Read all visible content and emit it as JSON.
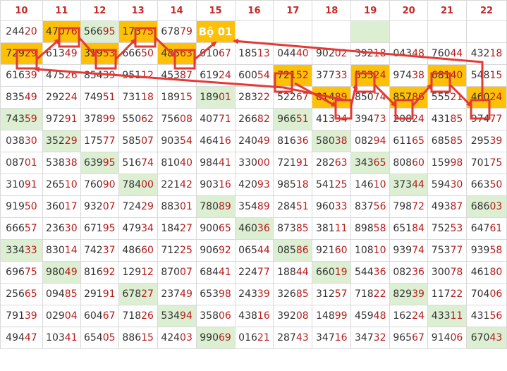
{
  "headers": [
    "10",
    "11",
    "12",
    "13",
    "14",
    "15",
    "16",
    "17",
    "18",
    "19",
    "20",
    "21",
    "22"
  ],
  "bo_label": "Bộ 01",
  "colors": {
    "highlight": "#ffc107",
    "green": "#dcefd2",
    "mark": "#e53935",
    "header_text": "#c62828"
  },
  "rows": [
    [
      {
        "v": "24420"
      },
      {
        "v": "47076",
        "h": "o"
      },
      {
        "v": "56695",
        "h": "g"
      },
      {
        "v": "17375",
        "h": "o"
      },
      {
        "v": "67879"
      },
      {
        "v": "Bộ 01",
        "h": "bo"
      },
      {
        "v": ""
      },
      {
        "v": ""
      },
      {
        "v": ""
      },
      {
        "v": "",
        "h": "g"
      },
      {
        "v": ""
      },
      {
        "v": ""
      },
      {
        "v": ""
      }
    ],
    [
      {
        "v": "72929",
        "h": "o"
      },
      {
        "v": "61349"
      },
      {
        "v": "31953",
        "h": "o"
      },
      {
        "v": "66650"
      },
      {
        "v": "48563",
        "h": "o"
      },
      {
        "v": "01067"
      },
      {
        "v": "18513"
      },
      {
        "v": "04440"
      },
      {
        "v": "90202"
      },
      {
        "v": "39218"
      },
      {
        "v": "04348"
      },
      {
        "v": "76044"
      },
      {
        "v": "43218"
      }
    ],
    [
      {
        "v": "61639"
      },
      {
        "v": "47526"
      },
      {
        "v": "85439"
      },
      {
        "v": "95112"
      },
      {
        "v": "45387"
      },
      {
        "v": "61924"
      },
      {
        "v": "60054"
      },
      {
        "v": "72152",
        "h": "o"
      },
      {
        "v": "37733"
      },
      {
        "v": "55324",
        "h": "o"
      },
      {
        "v": "97438"
      },
      {
        "v": "68140",
        "h": "o"
      },
      {
        "v": "54815"
      }
    ],
    [
      {
        "v": "83549"
      },
      {
        "v": "29224"
      },
      {
        "v": "74951"
      },
      {
        "v": "73118"
      },
      {
        "v": "18915"
      },
      {
        "v": "18901",
        "h": "g"
      },
      {
        "v": "28322"
      },
      {
        "v": "52267"
      },
      {
        "v": "81489",
        "h": "o"
      },
      {
        "v": "85074"
      },
      {
        "v": "85786",
        "h": "o"
      },
      {
        "v": "55521"
      },
      {
        "v": "46024",
        "h": "o"
      }
    ],
    [
      {
        "v": "74359",
        "h": "g"
      },
      {
        "v": "97291"
      },
      {
        "v": "37899"
      },
      {
        "v": "55062"
      },
      {
        "v": "75608"
      },
      {
        "v": "40771"
      },
      {
        "v": "26682"
      },
      {
        "v": "96651",
        "h": "g"
      },
      {
        "v": "41334"
      },
      {
        "v": "39473"
      },
      {
        "v": "20824"
      },
      {
        "v": "43185"
      },
      {
        "v": "97477"
      }
    ],
    [
      {
        "v": "03830"
      },
      {
        "v": "35229",
        "h": "g"
      },
      {
        "v": "17577"
      },
      {
        "v": "58507"
      },
      {
        "v": "90354"
      },
      {
        "v": "46416"
      },
      {
        "v": "24049"
      },
      {
        "v": "81636"
      },
      {
        "v": "58038",
        "h": "g"
      },
      {
        "v": "08294"
      },
      {
        "v": "61165"
      },
      {
        "v": "68585"
      },
      {
        "v": "29539"
      }
    ],
    [
      {
        "v": "08701"
      },
      {
        "v": "53838"
      },
      {
        "v": "63995",
        "h": "g"
      },
      {
        "v": "51674"
      },
      {
        "v": "81040"
      },
      {
        "v": "98441"
      },
      {
        "v": "33000"
      },
      {
        "v": "72191"
      },
      {
        "v": "28263"
      },
      {
        "v": "34365",
        "h": "g"
      },
      {
        "v": "80860"
      },
      {
        "v": "15998"
      },
      {
        "v": "70175"
      }
    ],
    [
      {
        "v": "31091"
      },
      {
        "v": "26510"
      },
      {
        "v": "76090"
      },
      {
        "v": "78400",
        "h": "g"
      },
      {
        "v": "22142"
      },
      {
        "v": "90316"
      },
      {
        "v": "42093"
      },
      {
        "v": "98518"
      },
      {
        "v": "54125"
      },
      {
        "v": "14610"
      },
      {
        "v": "37344",
        "h": "g"
      },
      {
        "v": "59430"
      },
      {
        "v": "66350"
      }
    ],
    [
      {
        "v": "91950"
      },
      {
        "v": "36017"
      },
      {
        "v": "93207"
      },
      {
        "v": "72429"
      },
      {
        "v": "88301"
      },
      {
        "v": "78089",
        "h": "g"
      },
      {
        "v": "35489"
      },
      {
        "v": "28451"
      },
      {
        "v": "96033"
      },
      {
        "v": "83756"
      },
      {
        "v": "79872"
      },
      {
        "v": "49387"
      },
      {
        "v": "68603",
        "h": "g"
      }
    ],
    [
      {
        "v": "66657"
      },
      {
        "v": "23630"
      },
      {
        "v": "67195"
      },
      {
        "v": "47934"
      },
      {
        "v": "18427"
      },
      {
        "v": "90065"
      },
      {
        "v": "46036",
        "h": "g"
      },
      {
        "v": "87385"
      },
      {
        "v": "38111"
      },
      {
        "v": "89858"
      },
      {
        "v": "65184"
      },
      {
        "v": "75253"
      },
      {
        "v": "64761"
      }
    ],
    [
      {
        "v": "33433",
        "h": "g"
      },
      {
        "v": "83014"
      },
      {
        "v": "74237"
      },
      {
        "v": "48660"
      },
      {
        "v": "71225"
      },
      {
        "v": "90692"
      },
      {
        "v": "06544"
      },
      {
        "v": "08586",
        "h": "g"
      },
      {
        "v": "92160"
      },
      {
        "v": "10810"
      },
      {
        "v": "93974"
      },
      {
        "v": "75377"
      },
      {
        "v": "93958"
      }
    ],
    [
      {
        "v": "69675"
      },
      {
        "v": "98049",
        "h": "g"
      },
      {
        "v": "81692"
      },
      {
        "v": "12912"
      },
      {
        "v": "87007"
      },
      {
        "v": "68441"
      },
      {
        "v": "22477"
      },
      {
        "v": "18844"
      },
      {
        "v": "66019",
        "h": "g"
      },
      {
        "v": "54436"
      },
      {
        "v": "08236"
      },
      {
        "v": "30078"
      },
      {
        "v": "46180"
      }
    ],
    [
      {
        "v": "25665"
      },
      {
        "v": "09485"
      },
      {
        "v": "29191"
      },
      {
        "v": "67827",
        "h": "g"
      },
      {
        "v": "23749"
      },
      {
        "v": "65398"
      },
      {
        "v": "24339"
      },
      {
        "v": "32685"
      },
      {
        "v": "31257"
      },
      {
        "v": "71822"
      },
      {
        "v": "82939",
        "h": "g"
      },
      {
        "v": "11722"
      },
      {
        "v": "70406"
      }
    ],
    [
      {
        "v": "79139"
      },
      {
        "v": "02904"
      },
      {
        "v": "60467"
      },
      {
        "v": "71826"
      },
      {
        "v": "53494",
        "h": "g"
      },
      {
        "v": "35806"
      },
      {
        "v": "43816"
      },
      {
        "v": "39208"
      },
      {
        "v": "14899"
      },
      {
        "v": "45948"
      },
      {
        "v": "16224"
      },
      {
        "v": "43311",
        "h": "g"
      },
      {
        "v": "43156"
      }
    ],
    [
      {
        "v": "49447"
      },
      {
        "v": "10341"
      },
      {
        "v": "65405"
      },
      {
        "v": "88615"
      },
      {
        "v": "42403"
      },
      {
        "v": "99069",
        "h": "g"
      },
      {
        "v": "01621"
      },
      {
        "v": "28743"
      },
      {
        "v": "34716"
      },
      {
        "v": "34732"
      },
      {
        "v": "96567"
      },
      {
        "v": "91406"
      },
      {
        "v": "67043",
        "h": "g"
      }
    ]
  ]
}
